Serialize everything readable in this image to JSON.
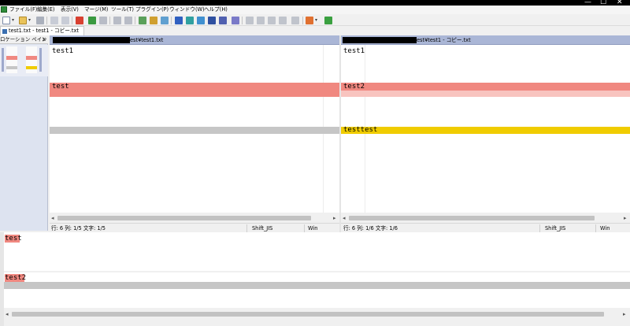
{
  "menu": {
    "items": [
      "ファイル(F)",
      "編集(E)",
      "表示(V)",
      "マージ(M)",
      "ツール(T)",
      "プラグイン(P)",
      "ウィンドウ(W)",
      "ヘルプ(H)"
    ]
  },
  "window_controls": {
    "minimize": "—",
    "maximize": "☐",
    "close": "✕"
  },
  "tab": {
    "title": "test1.txt - test1 - コピー.txt"
  },
  "location_pane": {
    "title": "ロケーション ペイン",
    "close": "×"
  },
  "left_pane": {
    "path": "est¥test1.txt",
    "lines": {
      "line1": "test1",
      "diff1": "test"
    }
  },
  "right_pane": {
    "path": "est¥test1 - コピー.txt",
    "lines": {
      "line1": "test1",
      "diff1": "test2",
      "diff2": "testtest"
    }
  },
  "left_status": {
    "position": "行: 6 列: 1/5 文字: 1/5",
    "encoding": "Shift_JIS",
    "eol": "Win"
  },
  "right_status": {
    "position": "行: 6 列: 1/6 文字: 1/6",
    "encoding": "Shift_JIS",
    "eol": "Win"
  },
  "detail": {
    "top_text": "test",
    "bottom_text": "test2"
  },
  "colors": {
    "diff_red": "#f08880",
    "diff_pink": "#f8c4bf",
    "diff_grey": "#c6c6c6",
    "diff_yellow": "#f0cc00",
    "header_blue": "#aab6d6"
  }
}
